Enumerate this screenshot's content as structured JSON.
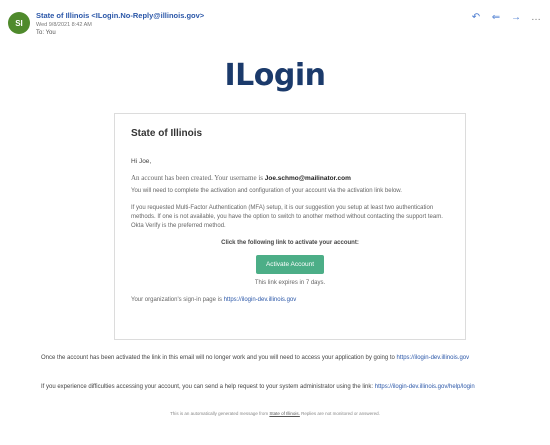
{
  "header": {
    "avatar_initials": "SI",
    "sender": "State of Illinois <ILogin.No-Reply@illinois.gov>",
    "date": "Wed 9/8/2021 8:42 AM",
    "to": "To: You",
    "actions": [
      {
        "name": "reply-icon",
        "glyph": "↶"
      },
      {
        "name": "reply-all-icon",
        "glyph": "⇐"
      },
      {
        "name": "forward-icon",
        "glyph": "→"
      },
      {
        "name": "more-icon",
        "glyph": "…"
      }
    ]
  },
  "logo": {
    "text": "ILogin"
  },
  "card": {
    "title": "State of Illinois",
    "greeting": "Hi Joe,",
    "created_prefix": "An account has been created. Your username is ",
    "username": "Joe.schmo@mailinator.com",
    "instructions": "You will need to complete the activation and configuration of your account via the activation link below.",
    "mfa": "If you requested Multi-Factor Authentication (MFA) setup, it is our suggestion you setup at least two authentication methods. If one is not available, you have the option to switch to another method without contacting the support team. Okta Verify is the preferred method.",
    "cta_label": "Click the following link to activate your account:",
    "button_label": "Activate Account",
    "expires": "This link expires in 7 days.",
    "signin_prefix": "Your organization's sign-in page is ",
    "signin_link": "https://ilogin-dev.illinois.gov"
  },
  "footer": {
    "line1_prefix": "Once the account has been activated the link in this email will no longer work and you will need to access your application by going to ",
    "line1_link": "https://ilogin-dev.illinois.gov",
    "line2_prefix": "If you experience difficulties accessing your account, you can send a help request to your system administrator using the link: ",
    "line2_link": "https://ilogin-dev.illinois.gov/help/login",
    "auto_prefix": "This is an automatically generated message from ",
    "auto_org": "State of Illinois.",
    "auto_suffix": " Replies are not monitored or answered."
  },
  "colors": {
    "sender_blue": "#2b57a8",
    "avatar_green": "#4f8a2c",
    "button_green": "#4cae87",
    "logo_navy": "#1b3a6b",
    "logo_red": "#d63a2b"
  }
}
